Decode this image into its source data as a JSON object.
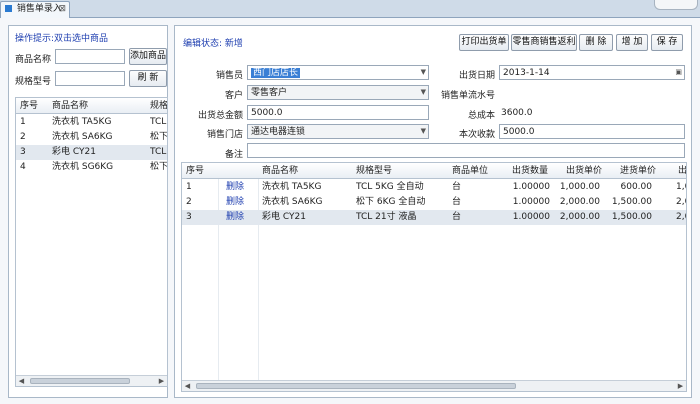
{
  "tab": {
    "title": "销售单录入"
  },
  "left": {
    "hint": "操作提示:双击选中商品",
    "product_name_label": "商品名称",
    "product_name_value": "",
    "add_button": "添加商品",
    "model_label": "规格型号",
    "model_value": "",
    "refresh_button": "刷 新",
    "columns": [
      "序号",
      "商品名称",
      "规格"
    ],
    "rows": [
      {
        "no": "1",
        "name": "洗衣机 TA5KG",
        "spec": "TCL"
      },
      {
        "no": "2",
        "name": "洗衣机 SA6KG",
        "spec": "松下"
      },
      {
        "no": "3",
        "name": "彩电 CY21",
        "spec": "TCL"
      },
      {
        "no": "4",
        "name": "洗衣机 SG6KG",
        "spec": "松下"
      }
    ],
    "selected_row": 2
  },
  "right": {
    "status_label": "编辑状态:",
    "status_value": "新增",
    "buttons": [
      "打印出货单",
      "零售商销售返利",
      "删 除",
      "增 加",
      "保 存"
    ],
    "form": {
      "salesperson_label": "销售员",
      "salesperson_value": "西门店店长",
      "date_label": "出货日期",
      "date_value": "2013-1-14",
      "customer_label": "客户",
      "customer_value": "零售客户",
      "serial_label": "销售单流水号",
      "serial_value": "",
      "total_label": "出货总金额",
      "total_value": "5000.0",
      "cost_label": "总成本",
      "cost_value": "3600.0",
      "store_label": "销售门店",
      "store_value": "通达电器连锁",
      "received_label": "本次收款",
      "received_value": "5000.0",
      "remark_label": "备注",
      "remark_value": ""
    },
    "grid": {
      "columns": [
        "序号",
        "",
        "商品名称",
        "规格型号",
        "商品单位",
        "出货数量",
        "出货单价",
        "进货单价",
        "出"
      ],
      "rows": [
        {
          "no": "1",
          "action": "删除",
          "name": "洗衣机 TA5KG",
          "spec": "TCL 5KG 全自动",
          "unit": "台",
          "qty": "1.00000",
          "price": "1,000.00",
          "cost": "600.00",
          "extra": "1,0"
        },
        {
          "no": "2",
          "action": "删除",
          "name": "洗衣机 SA6KG",
          "spec": "松下 6KG 全自动",
          "unit": "台",
          "qty": "1.00000",
          "price": "2,000.00",
          "cost": "1,500.00",
          "extra": "2,0"
        },
        {
          "no": "3",
          "action": "删除",
          "name": "彩电 CY21",
          "spec": "TCL 21寸 液晶",
          "unit": "台",
          "qty": "1.00000",
          "price": "2,000.00",
          "cost": "1,500.00",
          "extra": "2,0"
        }
      ],
      "selected_row": 2
    }
  },
  "colors": {
    "accent": "#1f3fb0",
    "highlight": "#3a7fd5",
    "selected_row": "#e2e8ef"
  }
}
